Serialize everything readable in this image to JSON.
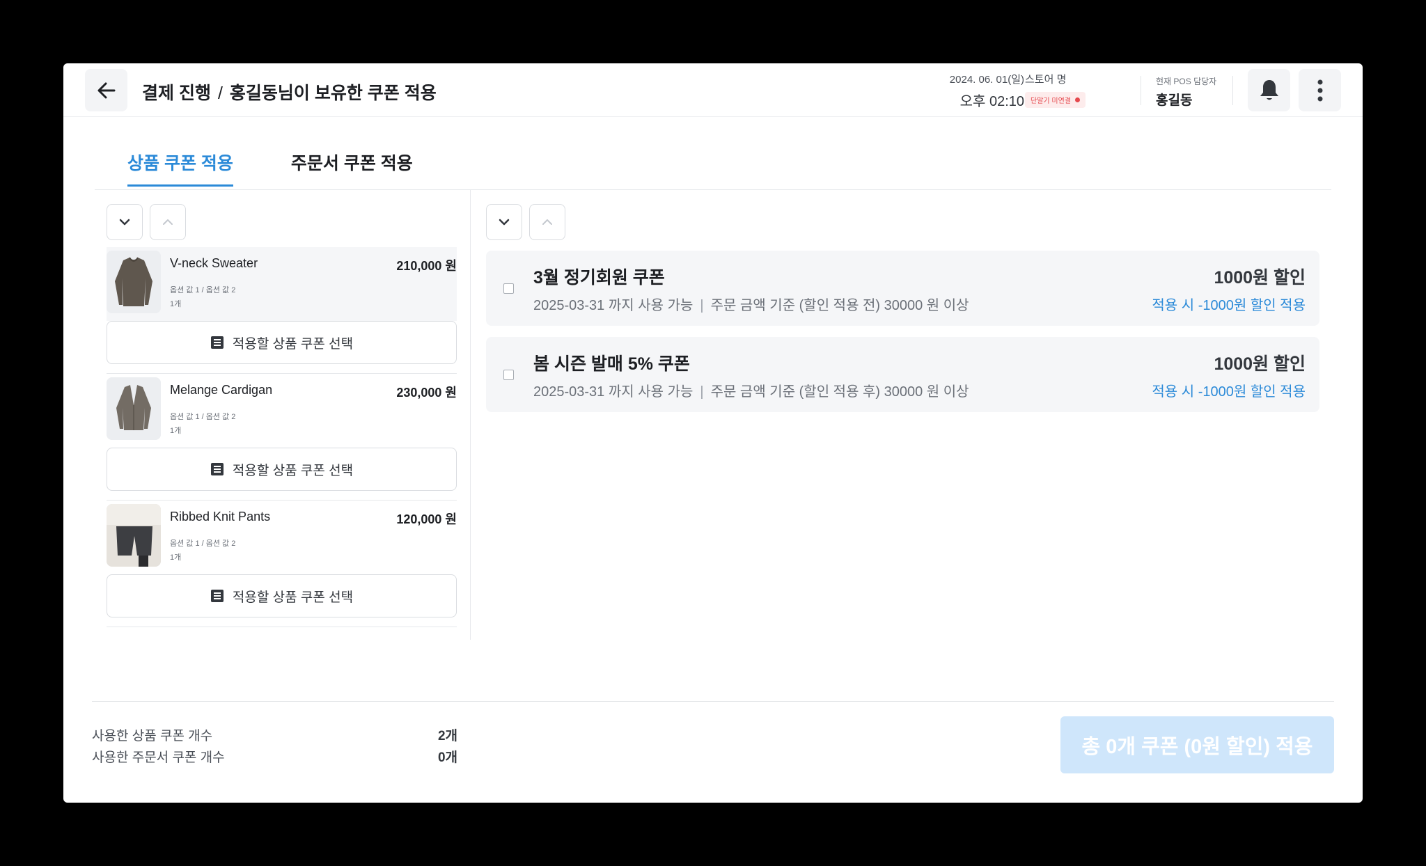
{
  "header": {
    "breadcrumb_parent": "결제 진행",
    "breadcrumb_separator": "/",
    "breadcrumb_current": "홍길동님이 보유한 쿠폰 적용",
    "date": "2024. 06. 01(일)",
    "time": "오후 02:10",
    "store_label": "스토어 명",
    "store_status": "단말기 미연결",
    "staff_label": "현재 POS 담당자",
    "staff_name": "홍길동"
  },
  "tabs": [
    {
      "label": "상품 쿠폰 적용",
      "active": true
    },
    {
      "label": "주문서 쿠폰 적용",
      "active": false
    }
  ],
  "products": [
    {
      "name": "V-neck Sweater",
      "price": "210,000 원",
      "options": "옵션 값 1 / 옵션 값 2",
      "qty": "1개",
      "select_label": "적용할 상품 쿠폰 선택"
    },
    {
      "name": "Melange Cardigan",
      "price": "230,000 원",
      "options": "옵션 값 1 / 옵션 값 2",
      "qty": "1개",
      "select_label": "적용할 상품 쿠폰 선택"
    },
    {
      "name": "Ribbed Knit Pants",
      "price": "120,000 원",
      "options": "옵션 값 1 / 옵션 값 2",
      "qty": "1개",
      "select_label": "적용할 상품 쿠폰 선택"
    }
  ],
  "coupons": [
    {
      "name": "3월 정기회원 쿠폰",
      "expiry": "2025-03-31 까지 사용 가능",
      "condition": "주문 금액 기준 (할인 적용 전) 30000 원 이상",
      "amount": "1000원 할인",
      "apply_text": "적용 시 -1000원 할인 적용",
      "checked": false
    },
    {
      "name": "봄 시즌 발매 5% 쿠폰",
      "expiry": "2025-03-31 까지 사용 가능",
      "condition": "주문 금액 기준 (할인 적용 후) 30000 원 이상",
      "amount": "1000원 할인",
      "apply_text": "적용 시 -1000원 할인 적용",
      "checked": false
    }
  ],
  "summary": {
    "product_coupon_label": "사용한 상품 쿠폰 개수",
    "product_coupon_count": "2개",
    "order_coupon_label": "사용한 주문서 쿠폰 개수",
    "order_coupon_count": "0개",
    "apply_button": "총 0개 쿠폰 (0원 할인) 적용"
  },
  "colors": {
    "accent": "#2b8ad8",
    "warning": "#e5484d",
    "apply_disabled": "#cfe6fb"
  },
  "icons": [
    "back-arrow-icon",
    "bell-icon",
    "more-vertical-icon",
    "chevron-down-icon",
    "chevron-up-icon",
    "list-icon"
  ]
}
